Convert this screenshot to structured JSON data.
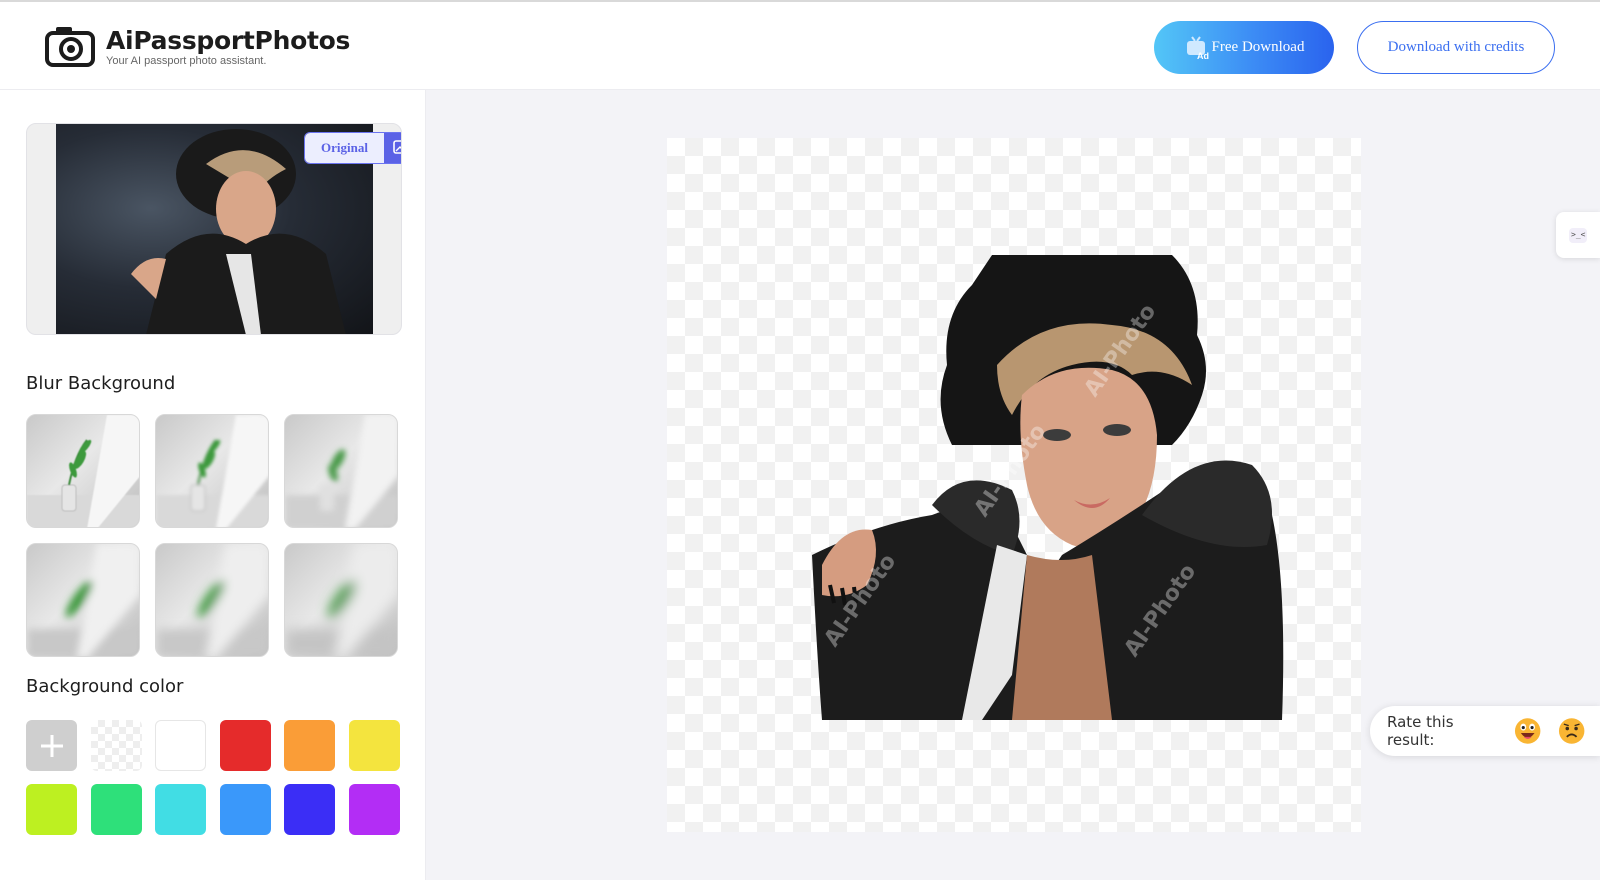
{
  "brand": {
    "title": "AiPassportPhotos",
    "tagline": "Your AI passport photo assistant."
  },
  "header": {
    "free_download_label": "Free Download",
    "ad_badge": "Ad",
    "credits_label": "Download with credits"
  },
  "preview": {
    "toggle_label": "Original"
  },
  "blur_background": {
    "title": "Blur Background",
    "options": [
      "blur-1",
      "blur-2",
      "blur-3",
      "blur-4",
      "blur-5",
      "blur-6"
    ]
  },
  "background_color": {
    "title": "Background color",
    "swatches": [
      {
        "name": "custom",
        "color": "#cfcfcf"
      },
      {
        "name": "transparent",
        "color": "transparent"
      },
      {
        "name": "white",
        "color": "#ffffff"
      },
      {
        "name": "red",
        "color": "#e52b2b"
      },
      {
        "name": "orange",
        "color": "#fa9d37"
      },
      {
        "name": "yellow",
        "color": "#f4e43e"
      },
      {
        "name": "lime",
        "color": "#bdf021"
      },
      {
        "name": "green",
        "color": "#2ee07a"
      },
      {
        "name": "cyan",
        "color": "#41dde4"
      },
      {
        "name": "blue",
        "color": "#3a98fa"
      },
      {
        "name": "indigo",
        "color": "#3b2ef6"
      },
      {
        "name": "purple",
        "color": "#b32df5"
      }
    ]
  },
  "canvas": {
    "watermark": "AI-Photo"
  },
  "rating": {
    "label": "Rate this result:",
    "options": [
      "happy-emoji",
      "sad-emoji"
    ]
  }
}
